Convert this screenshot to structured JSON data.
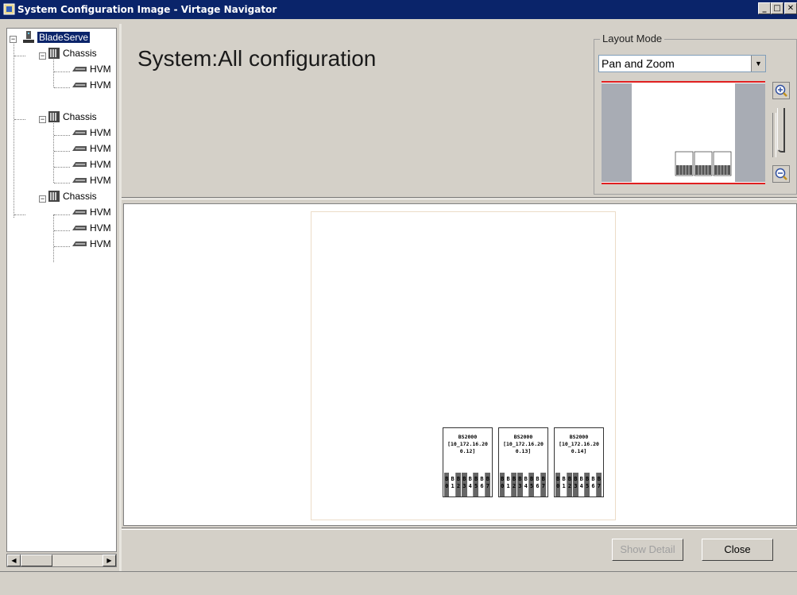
{
  "window": {
    "title": "System Configuration Image - Virtage Navigator",
    "minimize": "_",
    "maximize": "□",
    "close": "✕"
  },
  "tree": {
    "root": "BladeServe",
    "chassis": [
      {
        "label": "Chassis",
        "children": [
          "HVM",
          "HVM"
        ]
      },
      {
        "label": "Chassis",
        "children": [
          "HVM",
          "HVM",
          "HVM",
          "HVM"
        ]
      },
      {
        "label": "Chassis",
        "children": [
          "HVM",
          "HVM",
          "HVM"
        ]
      }
    ]
  },
  "header": {
    "title": "System:All configuration"
  },
  "layout_mode": {
    "legend": "Layout Mode",
    "selected": "Pan and Zoom"
  },
  "canvas": {
    "chassis": [
      {
        "line1": "BS2000",
        "line2": "[10_172.16.20",
        "line3": "0.12]",
        "slots": [
          "0",
          "1",
          "2",
          "3",
          "4",
          "5",
          "6",
          "7"
        ]
      },
      {
        "line1": "BS2000",
        "line2": "[10_172.16.20",
        "line3": "0.13]",
        "slots": [
          "0",
          "1",
          "2",
          "3",
          "4",
          "5",
          "6",
          "7"
        ]
      },
      {
        "line1": "BS2000",
        "line2": "[10_172.16.20",
        "line3": "0.14]",
        "slots": [
          "0",
          "1",
          "2",
          "3",
          "4",
          "5",
          "6",
          "7"
        ]
      }
    ]
  },
  "buttons": {
    "show_detail": "Show Detail",
    "close": "Close"
  },
  "icons": {
    "app": "config-image-icon",
    "server": "server-icon",
    "chassis": "chassis-icon",
    "blade": "blade-icon",
    "zoom_in": "zoom-in-icon",
    "zoom_out": "zoom-out-icon"
  }
}
